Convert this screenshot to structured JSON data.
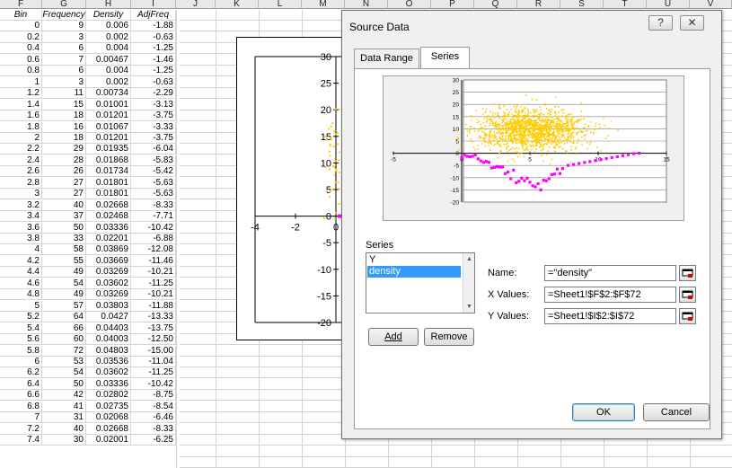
{
  "columns": [
    "F",
    "G",
    "H",
    "I",
    "J",
    "K",
    "L",
    "M",
    "N",
    "O",
    "P",
    "Q",
    "R",
    "S",
    "T",
    "U",
    "V"
  ],
  "table": {
    "headers": [
      "Bin",
      "Frequency",
      "Density",
      "AdjFreq"
    ],
    "rows": [
      [
        "0",
        "9",
        "0.006",
        "-1.88"
      ],
      [
        "0.2",
        "3",
        "0.002",
        "-0.63"
      ],
      [
        "0.4",
        "6",
        "0.004",
        "-1.25"
      ],
      [
        "0.6",
        "7",
        "0.00467",
        "-1.46"
      ],
      [
        "0.8",
        "6",
        "0.004",
        "-1.25"
      ],
      [
        "1",
        "3",
        "0.002",
        "-0.63"
      ],
      [
        "1.2",
        "11",
        "0.00734",
        "-2.29"
      ],
      [
        "1.4",
        "15",
        "0.01001",
        "-3.13"
      ],
      [
        "1.6",
        "18",
        "0.01201",
        "-3.75"
      ],
      [
        "1.8",
        "16",
        "0.01067",
        "-3.33"
      ],
      [
        "2",
        "18",
        "0.01201",
        "-3.75"
      ],
      [
        "2.2",
        "29",
        "0.01935",
        "-6.04"
      ],
      [
        "2.4",
        "28",
        "0.01868",
        "-5.83"
      ],
      [
        "2.6",
        "26",
        "0.01734",
        "-5.42"
      ],
      [
        "2.8",
        "27",
        "0.01801",
        "-5.63"
      ],
      [
        "3",
        "27",
        "0.01801",
        "-5.63"
      ],
      [
        "3.2",
        "40",
        "0.02668",
        "-8.33"
      ],
      [
        "3.4",
        "37",
        "0.02468",
        "-7.71"
      ],
      [
        "3.6",
        "50",
        "0.03336",
        "-10.42"
      ],
      [
        "3.8",
        "33",
        "0.02201",
        "-6.88"
      ],
      [
        "4",
        "58",
        "0.03869",
        "-12.08"
      ],
      [
        "4.2",
        "55",
        "0.03669",
        "-11.46"
      ],
      [
        "4.4",
        "49",
        "0.03269",
        "-10.21"
      ],
      [
        "4.6",
        "54",
        "0.03602",
        "-11.25"
      ],
      [
        "4.8",
        "49",
        "0.03269",
        "-10.21"
      ],
      [
        "5",
        "57",
        "0.03803",
        "-11.88"
      ],
      [
        "5.2",
        "64",
        "0.0427",
        "-13.33"
      ],
      [
        "5.4",
        "66",
        "0.04403",
        "-13.75"
      ],
      [
        "5.6",
        "60",
        "0.04003",
        "-12.50"
      ],
      [
        "5.8",
        "72",
        "0.04803",
        "-15.00"
      ],
      [
        "6",
        "53",
        "0.03536",
        "-11.04"
      ],
      [
        "6.2",
        "54",
        "0.03602",
        "-11.25"
      ],
      [
        "6.4",
        "50",
        "0.03336",
        "-10.42"
      ],
      [
        "6.6",
        "42",
        "0.02802",
        "-8.75"
      ],
      [
        "6.8",
        "41",
        "0.02735",
        "-8.54"
      ],
      [
        "7",
        "31",
        "0.02068",
        "-6.46"
      ],
      [
        "7.2",
        "40",
        "0.02668",
        "-8.33"
      ],
      [
        "7.4",
        "30",
        "0.02001",
        "-6.25"
      ]
    ]
  },
  "background_chart": {
    "y_ticks": [
      "30",
      "25",
      "20",
      "15",
      "10",
      "5",
      "0",
      "-5",
      "-10",
      "-15",
      "-20"
    ],
    "x_ticks": [
      "-4",
      "-2",
      "0"
    ]
  },
  "dialog": {
    "title": "Source Data",
    "help_glyph": "?",
    "close_glyph": "✕",
    "tabs": [
      "Data Range",
      "Series"
    ],
    "active_tab": "Series",
    "series_section_label": "Series",
    "series_list": [
      "Y",
      "density"
    ],
    "selected_series": "density",
    "add_label": "Add",
    "remove_label": "Remove",
    "name_label": "Name:",
    "name_value": "=\"density\"",
    "x_values_label": "X Values:",
    "x_values_value": "=Sheet1!$F$2:$F$72",
    "y_values_label": "Y Values:",
    "y_values_value": "=Sheet1!$I$2:$I$72",
    "ok_label": "OK",
    "cancel_label": "Cancel"
  },
  "colors": {
    "scatter_Y": "#ffcc00",
    "density_series": "#ff00ff",
    "selection": "#3399ff"
  },
  "chart_data": {
    "type": "scatter",
    "title": "",
    "xlim": [
      -5,
      15
    ],
    "ylim": [
      -20,
      30
    ],
    "x_ticks": [
      -5,
      0,
      5,
      10,
      15
    ],
    "y_ticks": [
      30,
      25,
      20,
      15,
      10,
      5,
      0,
      -5,
      -10,
      -15,
      -20
    ],
    "grid": true,
    "legend": "none",
    "series": [
      {
        "name": "Y",
        "description_source": "many points clustered around x≈5, y≈10",
        "approx_center": [
          5,
          10
        ]
      },
      {
        "name": "density",
        "x": [
          0,
          0.2,
          0.4,
          0.6,
          0.8,
          1,
          1.2,
          1.4,
          1.6,
          1.8,
          2,
          2.2,
          2.4,
          2.6,
          2.8,
          3,
          3.2,
          3.4,
          3.6,
          3.8,
          4,
          4.2,
          4.4,
          4.6,
          4.8,
          5,
          5.2,
          5.4,
          5.6,
          5.8,
          6,
          6.2,
          6.4,
          6.6,
          6.8,
          7,
          7.2,
          7.4
        ],
        "y": [
          -1.88,
          -0.63,
          -1.25,
          -1.46,
          -1.25,
          -0.63,
          -2.29,
          -3.13,
          -3.75,
          -3.33,
          -3.75,
          -6.04,
          -5.83,
          -5.42,
          -5.63,
          -5.63,
          -8.33,
          -7.71,
          -10.42,
          -6.88,
          -12.08,
          -11.46,
          -10.21,
          -11.25,
          -10.21,
          -11.88,
          -13.33,
          -13.75,
          -12.5,
          -15.0,
          -11.04,
          -11.25,
          -10.42,
          -8.75,
          -8.54,
          -6.46,
          -8.33,
          -6.25
        ]
      }
    ]
  }
}
